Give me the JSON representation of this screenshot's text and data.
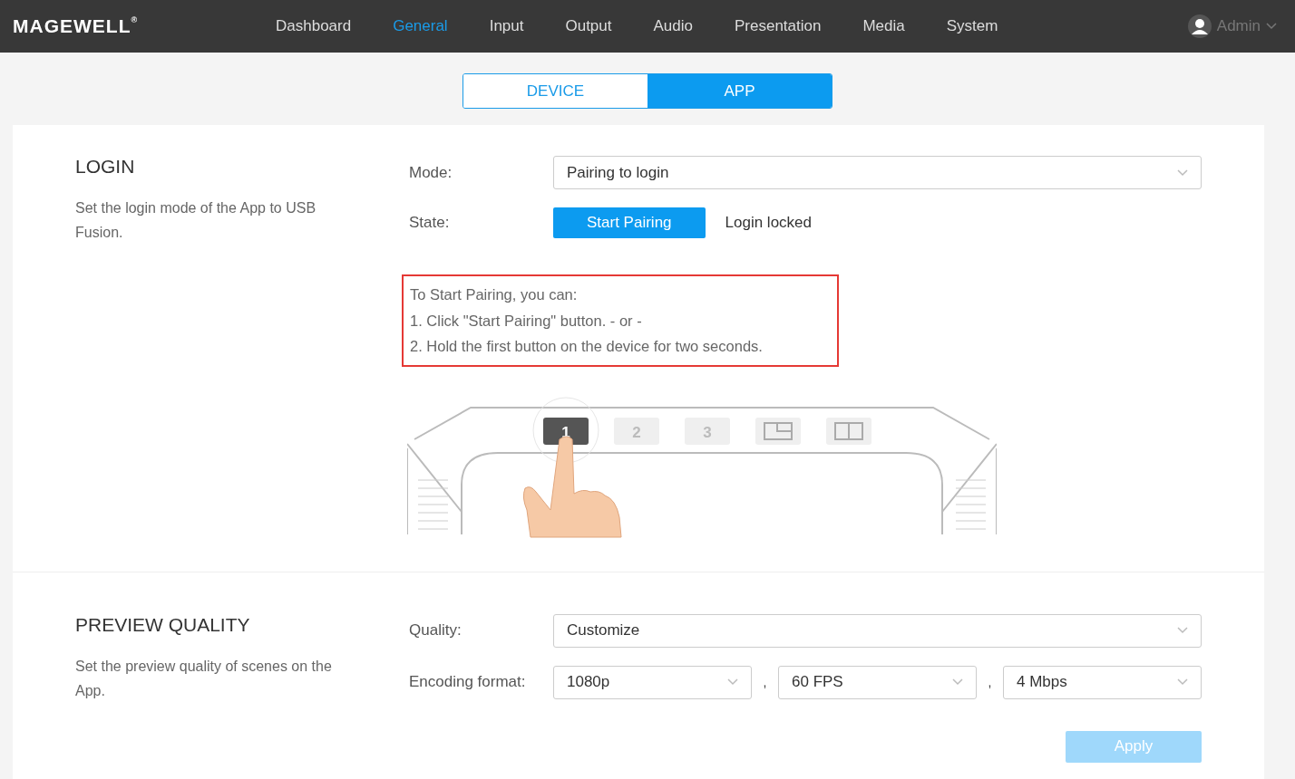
{
  "header": {
    "logo": "MAGEWELL",
    "logo_mark": "®",
    "nav": [
      {
        "label": "Dashboard",
        "selected": false
      },
      {
        "label": "General",
        "selected": true
      },
      {
        "label": "Input",
        "selected": false
      },
      {
        "label": "Output",
        "selected": false
      },
      {
        "label": "Audio",
        "selected": false
      },
      {
        "label": "Presentation",
        "selected": false
      },
      {
        "label": "Media",
        "selected": false
      },
      {
        "label": "System",
        "selected": false
      }
    ],
    "user": "Admin"
  },
  "tabs": [
    {
      "label": "DEVICE",
      "selected": false
    },
    {
      "label": "APP",
      "selected": true
    }
  ],
  "login": {
    "title": "LOGIN",
    "description": "Set the login mode of the App to USB Fusion.",
    "mode_label": "Mode:",
    "mode_value": "Pairing to login",
    "state_label": "State:",
    "pair_button": "Start Pairing",
    "state_value": "Login locked",
    "instructions": [
      "To Start Pairing, you can:",
      "1. Click \"Start Pairing\" button. - or -",
      "2. Hold the first button on the device for two seconds."
    ],
    "device_keys": [
      {
        "kind": "number",
        "label": "1",
        "selected": true
      },
      {
        "kind": "number",
        "label": "2",
        "selected": false
      },
      {
        "kind": "number",
        "label": "3",
        "selected": false
      },
      {
        "kind": "pip",
        "selected": false
      },
      {
        "kind": "split",
        "selected": false
      }
    ]
  },
  "preview": {
    "title": "PREVIEW QUALITY",
    "description": "Set the preview quality of scenes on the App.",
    "quality_label": "Quality:",
    "quality_value": "Customize",
    "format_label": "Encoding format:",
    "format_values": [
      "1080p",
      "60 FPS",
      "4 Mbps"
    ],
    "separator": ",",
    "apply": {
      "label": "Apply",
      "disabled": true
    }
  }
}
